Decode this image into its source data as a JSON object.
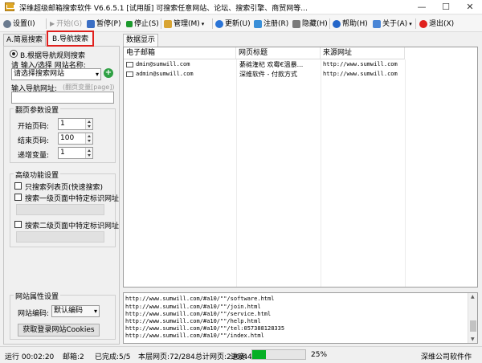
{
  "window": {
    "title": "深维超级邮箱搜索软件 V6.6.5.1 [试用版] 可搜索任意网站、论坛、搜索引擎、商贸网等...",
    "minimize": "—",
    "maximize": "☐",
    "close": "✕"
  },
  "toolbar": {
    "settings": "设置(I)",
    "start": "开始(G)",
    "pause": "暂停(P)",
    "stop": "停止(S)",
    "manage": "管理(M)",
    "update": "更新(U)",
    "register": "注册(R)",
    "hide": "隐藏(H)",
    "help": "帮助(H)",
    "about": "关于(A)",
    "exit": "退出(X)"
  },
  "tabs": {
    "simple": "A.简易搜索",
    "nav": "B.导航搜索",
    "data": "数据显示"
  },
  "nav": {
    "radio_label": "B.根据导航规则搜索",
    "select_label": "请 输入/选择 网站名称:",
    "select_value": "请选择搜索网站",
    "input_label": "输入导航网址:",
    "input_hint": "(翻页变量[page])",
    "input_value": ""
  },
  "paging": {
    "title": "翻页参数设置",
    "start_label": "开始页码:",
    "start_value": "1",
    "end_label": "结束页码:",
    "end_value": "100",
    "step_label": "递增变量:",
    "step_value": "1"
  },
  "advanced": {
    "title": "高级功能设置",
    "opt1": "只搜索列表页(快速搜索)",
    "opt2": "搜索一级页面中特定标识网址",
    "opt3": "搜索二级页面中特定标识网址"
  },
  "site": {
    "title": "网站属性设置",
    "encoding_label": "网站编码:",
    "encoding_value": "默认编码",
    "cookies_button": "获取登录网站Cookies"
  },
  "results": {
    "columns": [
      "电子邮箱",
      "网页标题",
      "来源网址"
    ],
    "rows": [
      {
        "email": "dmin@sumwill.com",
        "title": "綦裢潅杞  欢霉€溫暴...",
        "url": "http://www.sumwill.com"
      },
      {
        "email": "admin@sumwill.com",
        "title": "深维软件 - 付款方式",
        "url": "http://www.sumwill.com"
      }
    ]
  },
  "log": {
    "lines": [
      "http://www.sumwill.com/#a10/\"\"/software.html",
      "http://www.sumwill.com/#a10/\"\"/join.html",
      "http://www.sumwill.com/#a10/\"\"/service.html",
      "http://www.sumwill.com/#a10/\"\"/help.html",
      "http://www.sumwill.com/#a10/\"\"/tel:057388128335",
      "http://www.sumwill.com/#a10/\"\"/index.html"
    ]
  },
  "status": {
    "running": "运行 00:02:20",
    "mailboxes": "邮箱:2",
    "completed": "已完成:5/5",
    "layer_pages": "本层网页:72/284",
    "total_pages": "总计网页:236/448",
    "progress_label": "进度:",
    "progress_percent": 25,
    "progress_text": "25%",
    "company": "深维公司软件作"
  },
  "colors": {
    "progress": "#06b025",
    "accent_red": "#e0201d",
    "link_blue": "#1a5ccf"
  }
}
